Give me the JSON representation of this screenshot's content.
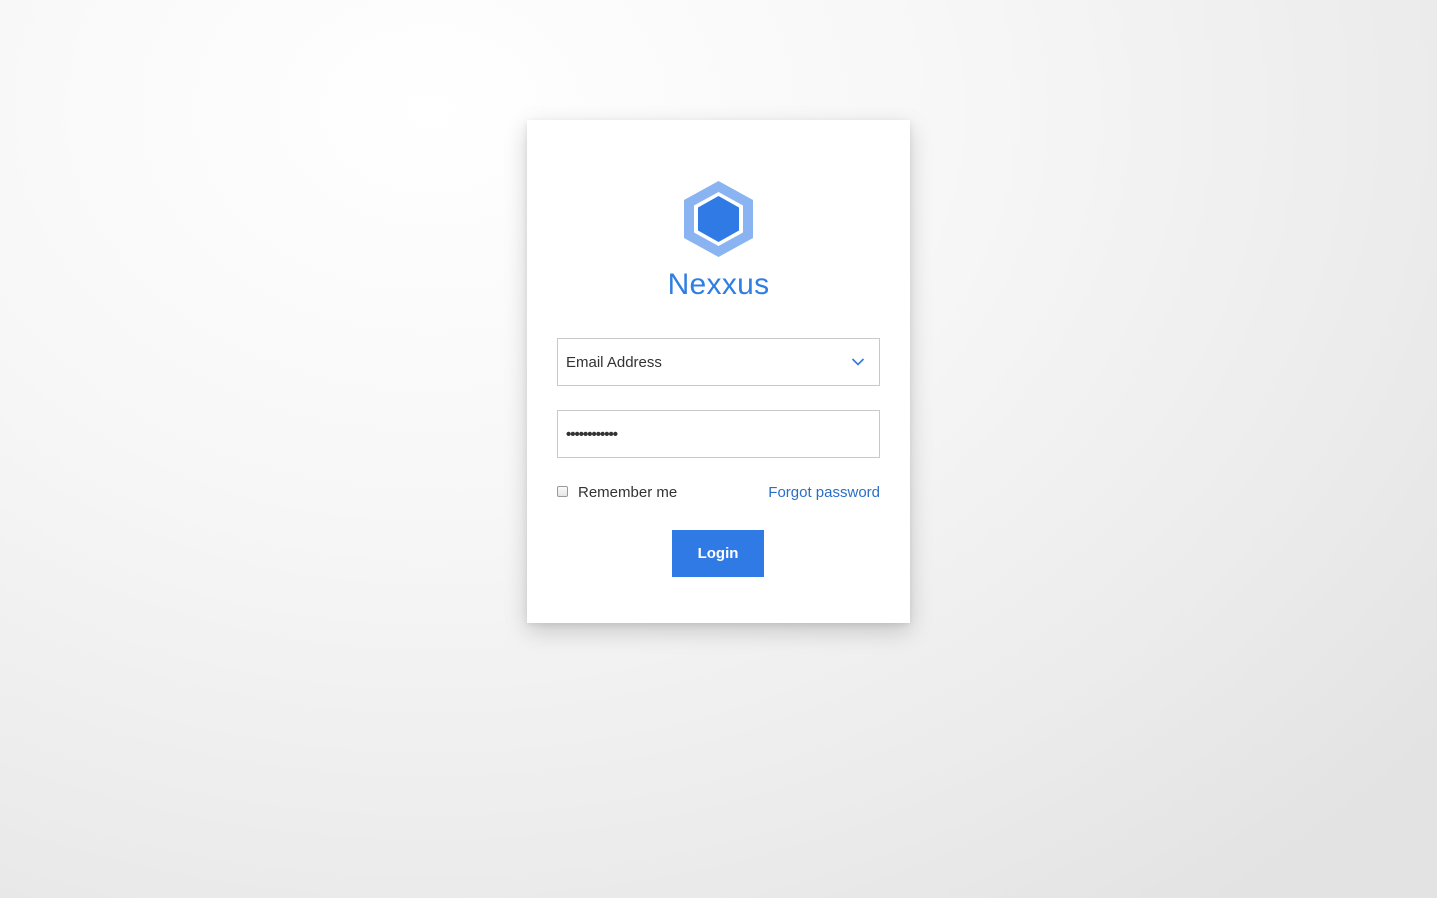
{
  "brand": {
    "name": "Nexxus",
    "logo_icon": "hexagon-icon",
    "colors": {
      "primary": "#2f7ee3",
      "logo_outer": "#8ab4f1",
      "logo_inner": "#2f7ae5"
    }
  },
  "form": {
    "email_field": {
      "value": "Email Address",
      "icon": "chevron-down-icon"
    },
    "password_field": {
      "value": "••••••••••••"
    },
    "remember_label": "Remember me",
    "remember_checked": false,
    "forgot_link": "Forgot password",
    "login_button": "Login"
  }
}
